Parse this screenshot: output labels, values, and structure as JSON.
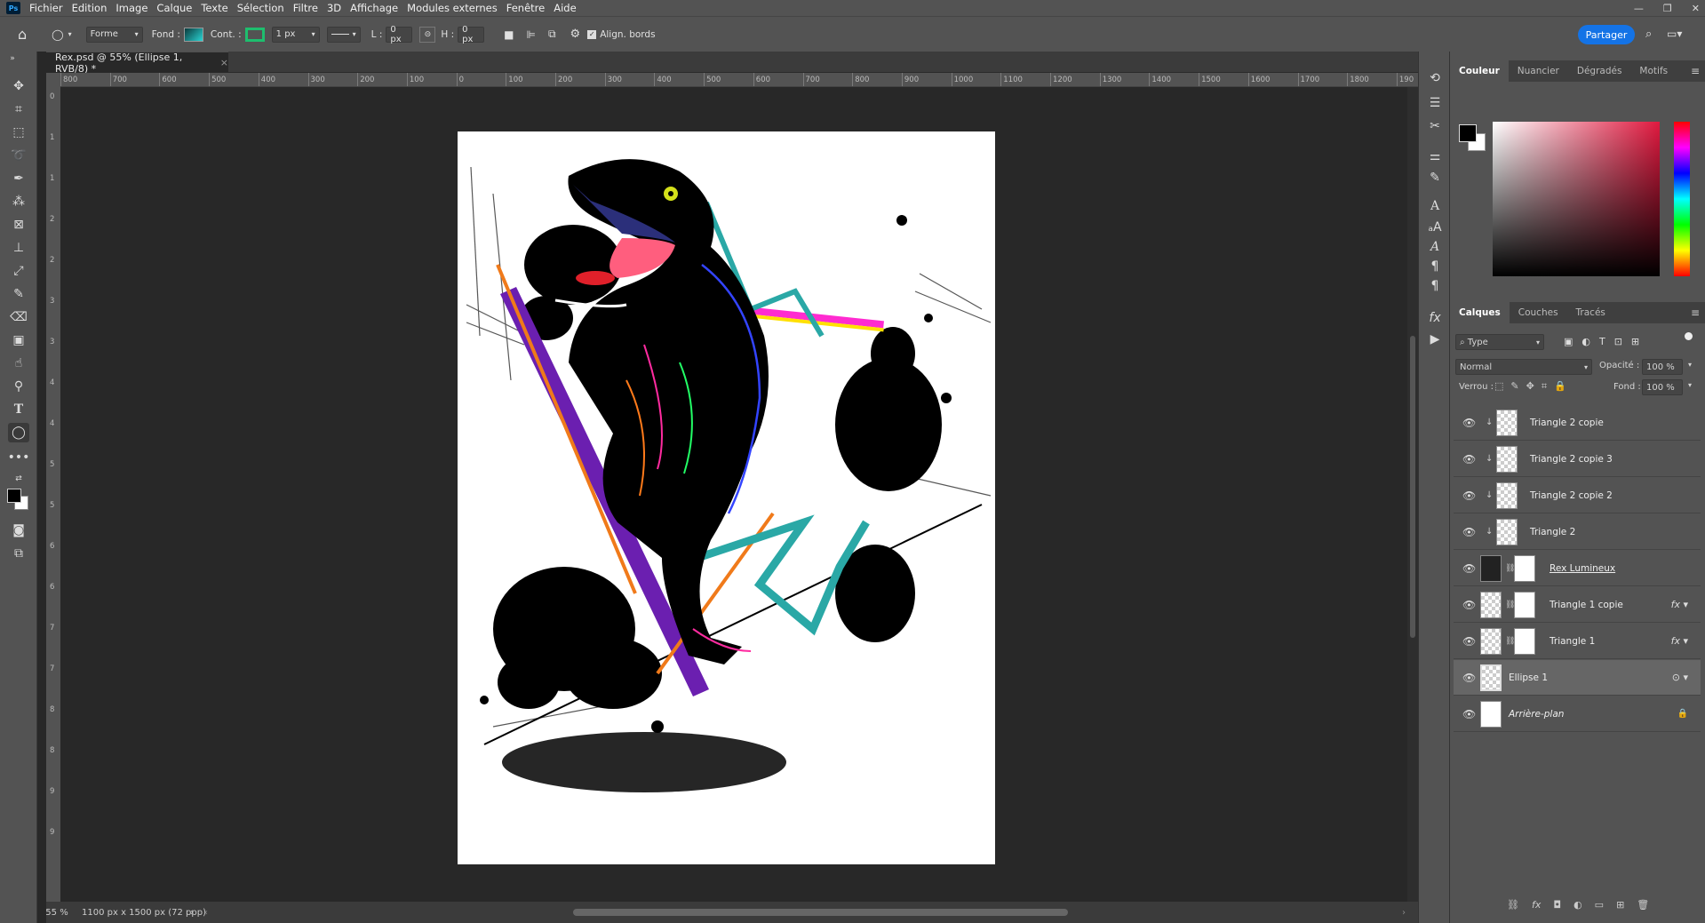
{
  "menu": [
    "Fichier",
    "Edition",
    "Image",
    "Calque",
    "Texte",
    "Sélection",
    "Filtre",
    "3D",
    "Affichage",
    "Modules externes",
    "Fenêtre",
    "Aide"
  ],
  "options": {
    "mode": "Forme",
    "fill_label": "Fond :",
    "stroke_label": "Cont. :",
    "stroke_width": "1 px",
    "w_label": "L :",
    "w_value": "0 px",
    "h_label": "H :",
    "h_value": "0 px",
    "align_edges": "Align. bords",
    "share_button": "Partager",
    "fill_color": "#14a3a6",
    "stroke_color": "#1ebe6e"
  },
  "document": {
    "tab_title": "Rex.psd @ 55% (Ellipse 1, RVB/8) *",
    "zoom": "55 %",
    "dimensions": "1100 px x 1500 px (72 ppp)"
  },
  "ruler": {
    "h": [
      "800",
      "700",
      "600",
      "500",
      "400",
      "300",
      "200",
      "100",
      "0",
      "100",
      "200",
      "300",
      "400",
      "500",
      "600",
      "700",
      "800",
      "900",
      "1000",
      "1100",
      "1200",
      "1300",
      "1400",
      "1500",
      "1600",
      "1700",
      "1800",
      "190"
    ],
    "v": [
      "0",
      "1",
      "1",
      "2",
      "2",
      "3",
      "3",
      "4",
      "4",
      "5",
      "5",
      "6",
      "6",
      "7",
      "7",
      "8",
      "8",
      "9",
      "9"
    ]
  },
  "color_panel": {
    "tabs": [
      "Couleur",
      "Nuancier",
      "Dégradés",
      "Motifs"
    ],
    "active": "Couleur"
  },
  "layers_panel": {
    "tabs": [
      "Calques",
      "Couches",
      "Tracés"
    ],
    "filter": "Type",
    "blend_mode": "Normal",
    "opacity_label": "Opacité :",
    "opacity": "100 %",
    "lock_label": "Verrou :",
    "fill_label": "Fond :",
    "fill": "100 %",
    "layers": [
      {
        "name": "Triangle 2 copie"
      },
      {
        "name": "Triangle 2 copie 3"
      },
      {
        "name": "Triangle 2 copie 2"
      },
      {
        "name": "Triangle 2"
      },
      {
        "name": "Rex Lumineux"
      },
      {
        "name": "Triangle 1 copie"
      },
      {
        "name": "Triangle 1"
      },
      {
        "name": "Ellipse 1"
      },
      {
        "name": "Arrière-plan"
      }
    ]
  }
}
